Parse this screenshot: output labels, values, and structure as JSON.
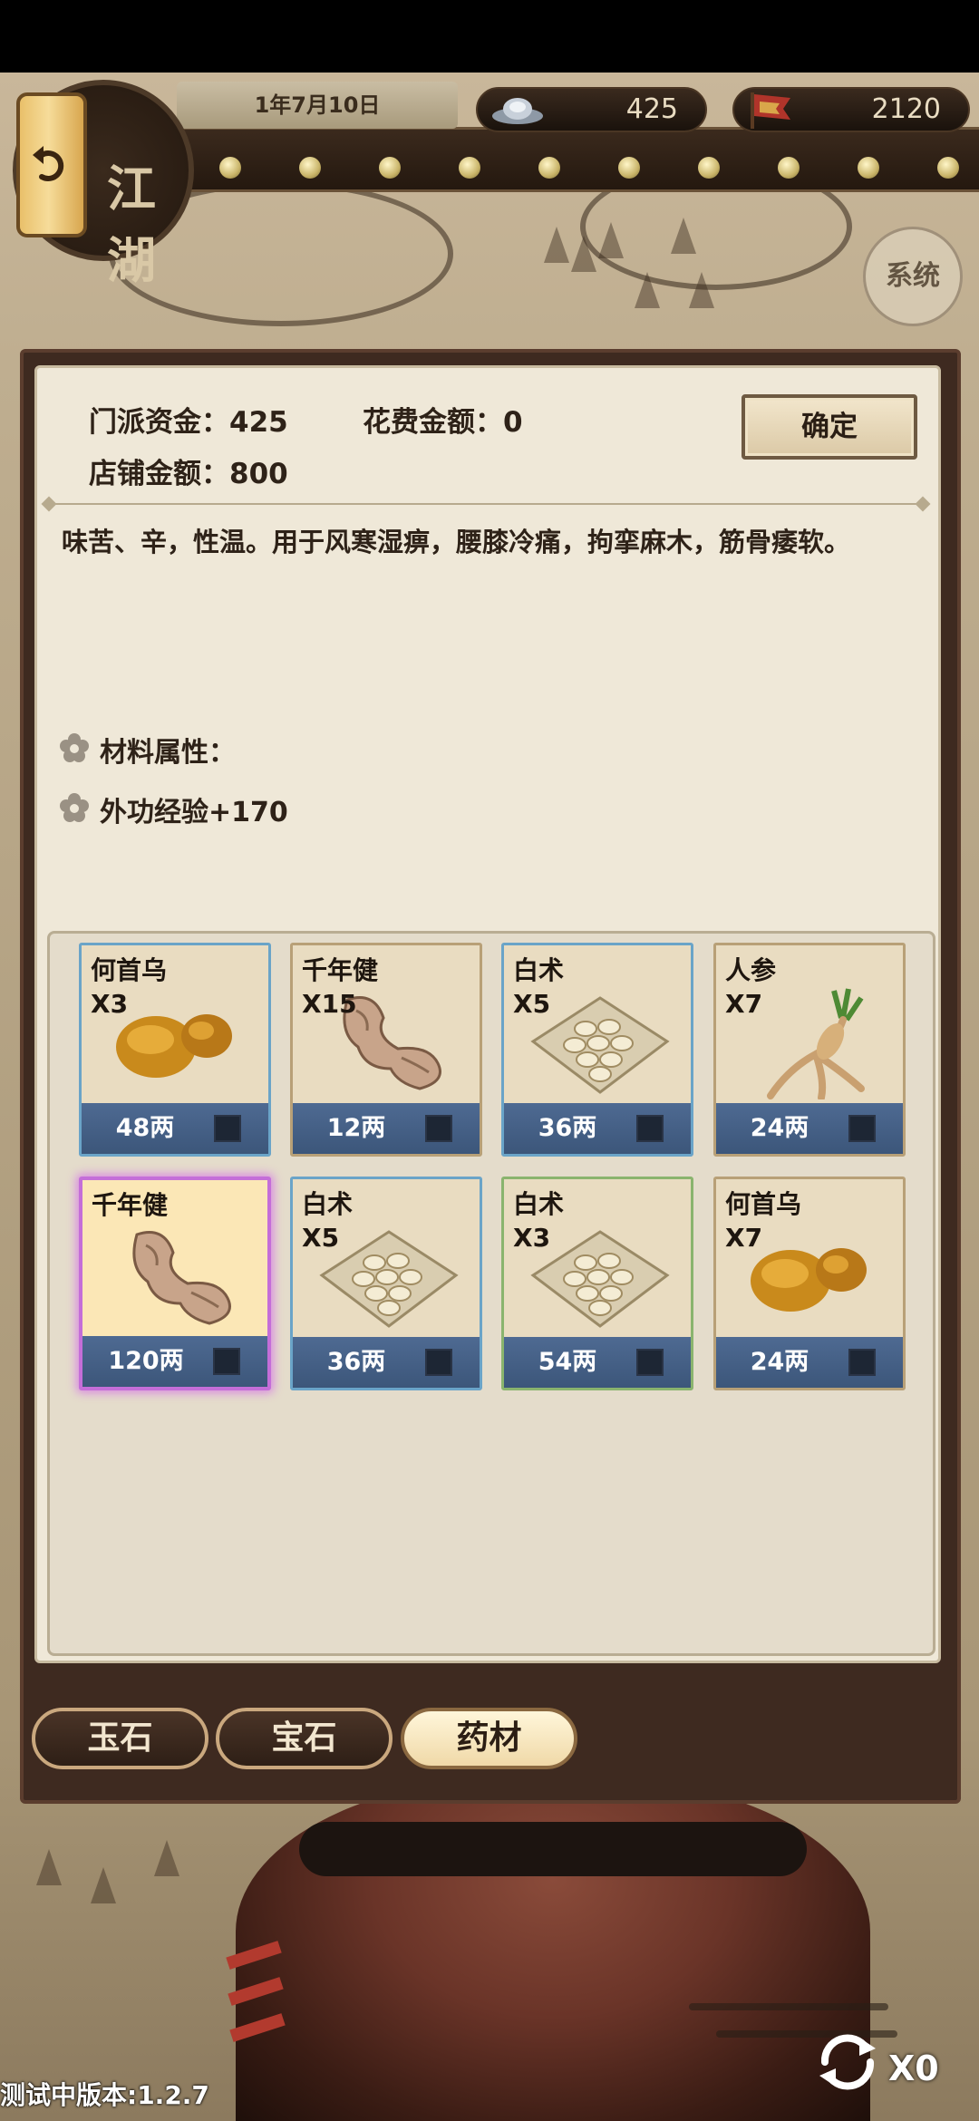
{
  "header": {
    "date": "1年7月10日",
    "silver": "425",
    "prestige": "2120",
    "emblem_text": "江湖",
    "system_label": "系统"
  },
  "panel": {
    "sect_funds_label": "门派资金：425",
    "cost_label": "花费金额：0",
    "shop_funds_label": "店铺金额：800",
    "confirm_label": "确定",
    "description": "味苦、辛，性温。用于风寒湿痹，腰膝冷痛，拘挛麻木，筋骨痿软。",
    "attr_title": "材料属性：",
    "attr_value": "外功经验+170"
  },
  "items": [
    {
      "name": "何首乌",
      "qty": "X3",
      "price": "48两",
      "art": "tuber-icon",
      "frame": "blue"
    },
    {
      "name": "千年健",
      "qty": "X15",
      "price": "12两",
      "art": "root-icon",
      "frame": "gold"
    },
    {
      "name": "白术",
      "qty": "X5",
      "price": "36两",
      "art": "slices-icon",
      "frame": "blue"
    },
    {
      "name": "人参",
      "qty": "X7",
      "price": "24两",
      "art": "ginseng-icon",
      "frame": "gold"
    },
    {
      "name": "千年健",
      "qty": "",
      "price": "120两",
      "art": "root-icon",
      "frame": "selected"
    },
    {
      "name": "白术",
      "qty": "X5",
      "price": "36两",
      "art": "slices-icon",
      "frame": "blue"
    },
    {
      "name": "白术",
      "qty": "X3",
      "price": "54两",
      "art": "slices-icon",
      "frame": "green"
    },
    {
      "name": "何首乌",
      "qty": "X7",
      "price": "24两",
      "art": "tuber-icon",
      "frame": "gold"
    }
  ],
  "tabs": [
    {
      "label": "玉石",
      "active": false
    },
    {
      "label": "宝石",
      "active": false
    },
    {
      "label": "药材",
      "active": true
    }
  ],
  "footer": {
    "version": "测试中版本:1.2.7",
    "refresh_count": "X0"
  },
  "colors": {
    "panel_bg": "#efe8d8",
    "frame_brown": "#3e2a20",
    "card_footer_blue": "#4e6a92",
    "selected_glow": "#c46ed8"
  }
}
